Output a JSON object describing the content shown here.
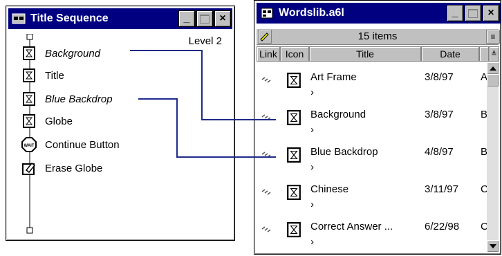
{
  "left_window": {
    "title": "Title Sequence",
    "level": "Level 2",
    "flow": [
      {
        "label": "Background",
        "italic": true,
        "icon": "display-icon"
      },
      {
        "label": "Title",
        "italic": false,
        "icon": "display-icon"
      },
      {
        "label": "Blue Backdrop",
        "italic": true,
        "icon": "display-icon"
      },
      {
        "label": "Globe",
        "italic": false,
        "icon": "display-icon"
      },
      {
        "label": "Continue Button",
        "italic": false,
        "icon": "wait-icon"
      },
      {
        "label": "Erase Globe",
        "italic": false,
        "icon": "erase-icon"
      }
    ]
  },
  "right_window": {
    "title": "Wordslib.a6l",
    "count": "15 items",
    "columns": {
      "link": "Link",
      "icon": "Icon",
      "title": "Title",
      "date": "Date"
    },
    "rows": [
      {
        "title": "Art Frame",
        "arrow": "›",
        "date": "3/8/97",
        "extra": "A"
      },
      {
        "title": "Background",
        "arrow": "›",
        "date": "3/8/97",
        "extra": "B"
      },
      {
        "title": "Blue Backdrop",
        "arrow": "›",
        "date": "4/8/97",
        "extra": "B"
      },
      {
        "title": "Chinese",
        "arrow": "›",
        "date": "3/11/97",
        "extra": "C"
      },
      {
        "title": "Correct Answer ...",
        "arrow": "›",
        "date": "6/22/98",
        "extra": "C"
      }
    ]
  },
  "controls": {
    "minimize": "_",
    "close": "×"
  },
  "colors": {
    "titlebar": "#000080",
    "chrome": "#c0c0c0",
    "connector": "#1f2a8a"
  }
}
